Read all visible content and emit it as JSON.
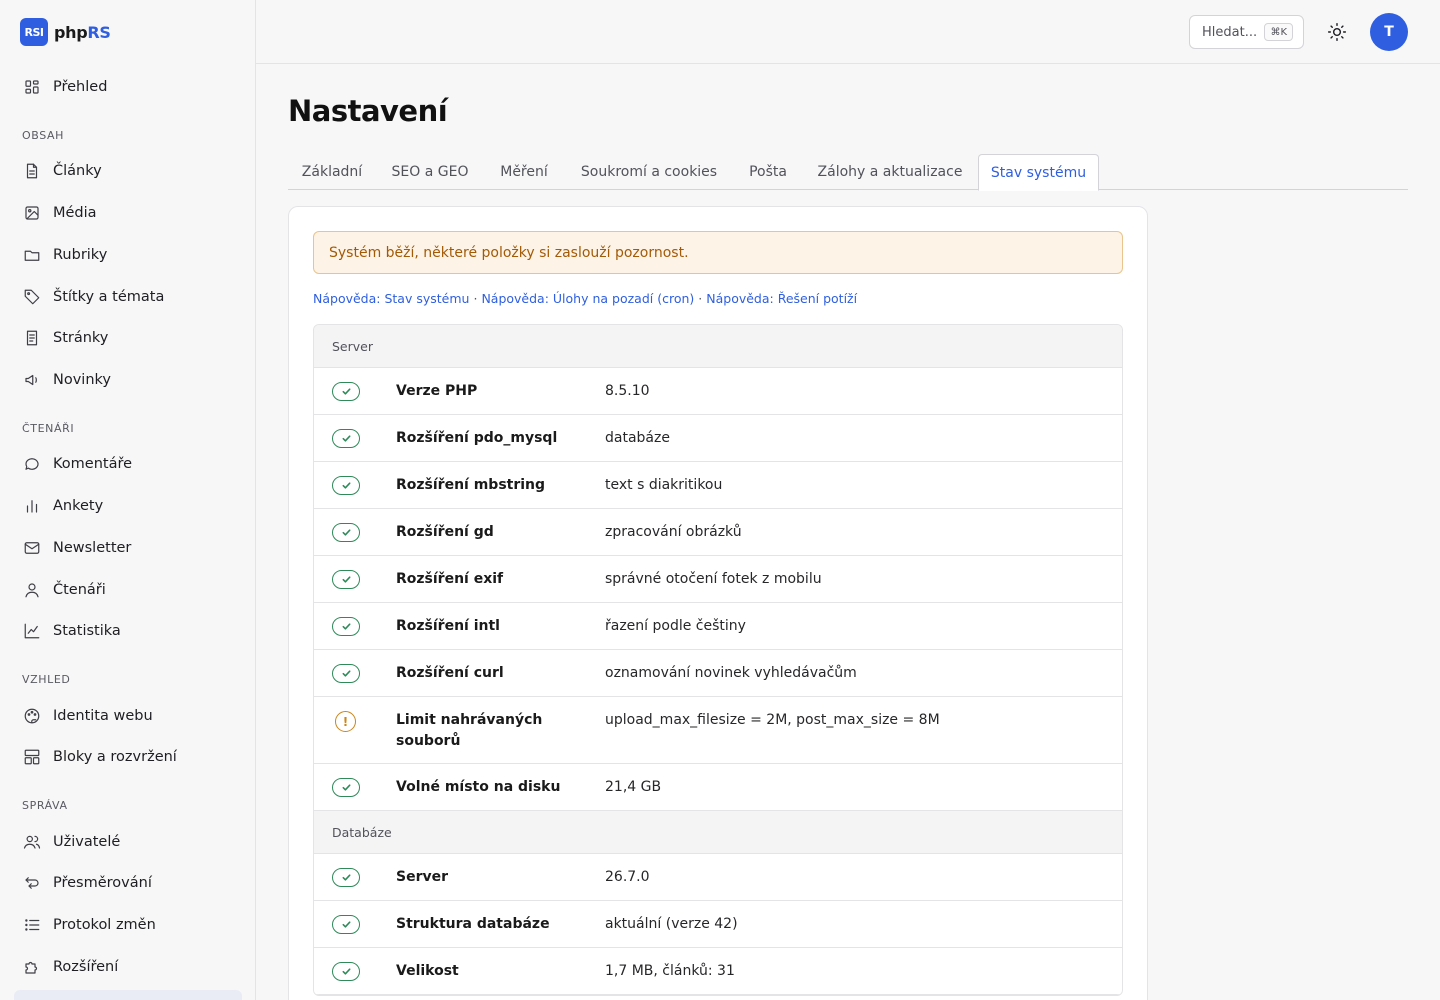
{
  "brand": {
    "logo": "RSI",
    "name_plain": "php",
    "name_accent": "RS"
  },
  "sidebar": {
    "overview": {
      "label": "Přehled",
      "icon": "grid-icon"
    },
    "sections": [
      {
        "title": "Obsah",
        "items": [
          {
            "label": "Články",
            "icon": "document-icon"
          },
          {
            "label": "Média",
            "icon": "image-icon"
          },
          {
            "label": "Rubriky",
            "icon": "folder-icon"
          },
          {
            "label": "Štítky a témata",
            "icon": "tag-icon"
          },
          {
            "label": "Stránky",
            "icon": "page-icon"
          },
          {
            "label": "Novinky",
            "icon": "megaphone-icon"
          }
        ]
      },
      {
        "title": "Čtenáři",
        "items": [
          {
            "label": "Komentáře",
            "icon": "comment-icon"
          },
          {
            "label": "Ankety",
            "icon": "poll-icon"
          },
          {
            "label": "Newsletter",
            "icon": "mail-icon"
          },
          {
            "label": "Čtenáři",
            "icon": "user-icon"
          },
          {
            "label": "Statistika",
            "icon": "chart-icon"
          }
        ]
      },
      {
        "title": "Vzhled",
        "items": [
          {
            "label": "Identita webu",
            "icon": "palette-icon"
          },
          {
            "label": "Bloky a rozvržení",
            "icon": "layout-icon"
          }
        ]
      },
      {
        "title": "Správa",
        "items": [
          {
            "label": "Uživatelé",
            "icon": "users-icon"
          },
          {
            "label": "Přesměrování",
            "icon": "redirect-icon"
          },
          {
            "label": "Protokol změn",
            "icon": "list-icon"
          },
          {
            "label": "Rozšíření",
            "icon": "puzzle-icon"
          }
        ]
      }
    ]
  },
  "topbar": {
    "search_placeholder": "Hledat...",
    "search_shortcut": "⌘K",
    "theme_icon": "sun-icon",
    "avatar_initial": "T"
  },
  "page": {
    "title": "Nastavení"
  },
  "tabs": [
    {
      "label": "Základní",
      "active": false
    },
    {
      "label": "SEO a GEO",
      "active": false
    },
    {
      "label": "Měření",
      "active": false
    },
    {
      "label": "Soukromí a cookies",
      "active": false
    },
    {
      "label": "Pošta",
      "active": false
    },
    {
      "label": "Zálohy a aktualizace",
      "active": false
    },
    {
      "label": "Stav systému",
      "active": true
    }
  ],
  "alert": {
    "text": "Systém běží, některé položky si zaslouží pozornost.",
    "color": "#a35a06"
  },
  "help_links": [
    "Nápověda: Stav systému",
    "Nápověda: Úlohy na pozadí (cron)",
    "Nápověda: Řešení potíží"
  ],
  "help_separator": "·",
  "groups": [
    {
      "title": "Server",
      "rows": [
        {
          "status": "ok",
          "name": "Verze PHP",
          "value": "8.5.10"
        },
        {
          "status": "ok",
          "name": "Rozšíření pdo_mysql",
          "value": "databáze"
        },
        {
          "status": "ok",
          "name": "Rozšíření mbstring",
          "value": "text s diakritikou"
        },
        {
          "status": "ok",
          "name": "Rozšíření gd",
          "value": "zpracování obrázků"
        },
        {
          "status": "ok",
          "name": "Rozšíření exif",
          "value": "správné otočení fotek z mobilu"
        },
        {
          "status": "ok",
          "name": "Rozšíření intl",
          "value": "řazení podle češtiny"
        },
        {
          "status": "ok",
          "name": "Rozšíření curl",
          "value": "oznamování novinek vyhledávačům"
        },
        {
          "status": "warn",
          "name": "Limit nahrávaných souborů",
          "value": "upload_max_filesize = 2M, post_max_size = 8M"
        },
        {
          "status": "ok",
          "name": "Volné místo na disku",
          "value": "21,4 GB"
        }
      ]
    },
    {
      "title": "Databáze",
      "rows": [
        {
          "status": "ok",
          "name": "Server",
          "value": "26.7.0"
        },
        {
          "status": "ok",
          "name": "Struktura databáze",
          "value": "aktuální (verze 42)"
        },
        {
          "status": "ok",
          "name": "Velikost",
          "value": "1,7 MB, článků: 31"
        }
      ]
    }
  ],
  "colors": {
    "accent": "#2f5fe0",
    "ok": "#2f8a5a",
    "warn": "#c9861a"
  }
}
